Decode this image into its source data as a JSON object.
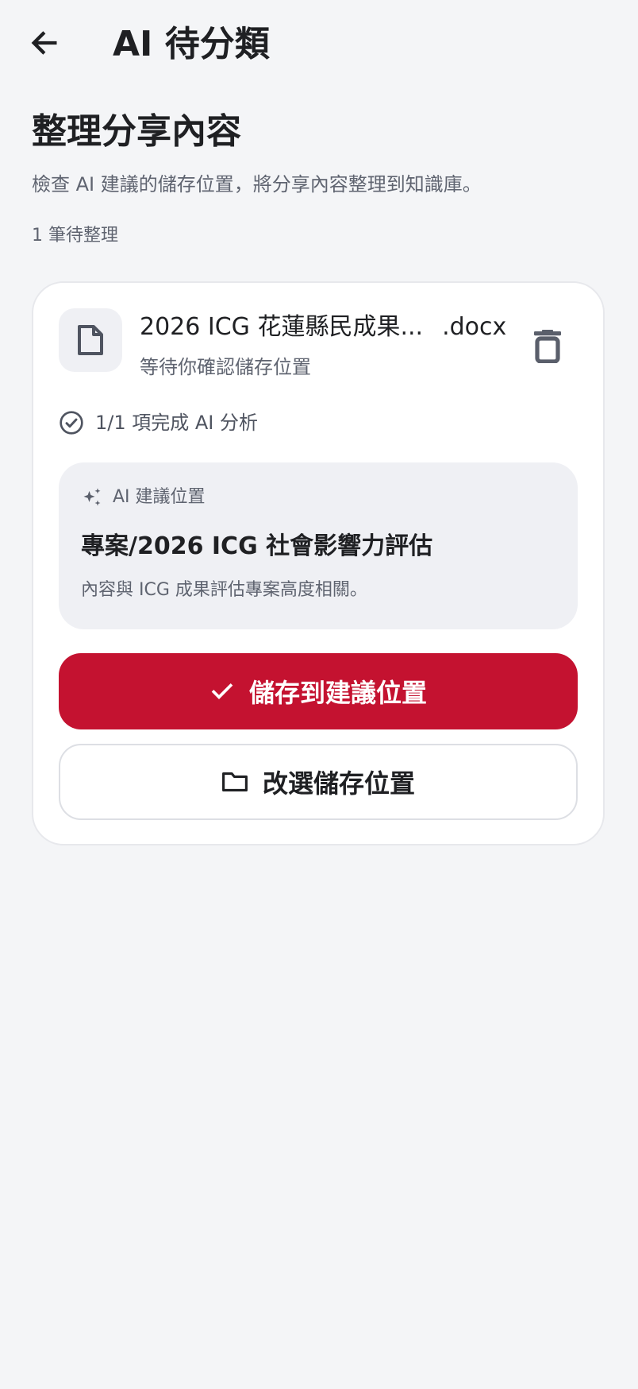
{
  "app_bar": {
    "title": "AI 待分類",
    "back_icon": "arrow-left-icon"
  },
  "section": {
    "heading": "整理分享內容",
    "description": "檢查 AI 建議的儲存位置，將分享內容整理到知識庫。",
    "pending_count": "1 筆待整理"
  },
  "item": {
    "file_icon": "document-icon",
    "file_name_stem": "2026 ICG 花蓮縣民成果...",
    "file_extension": ".docx",
    "status": "等待你確認儲存位置",
    "delete_icon": "trash-icon",
    "analysis_icon": "check-circle-icon",
    "analysis_text": "1/1 項完成 AI 分析",
    "suggestion": {
      "icon": "sparkle-icon",
      "label": "AI 建議位置",
      "path": "專案/2026 ICG 社會影響力評估",
      "reason": "內容與 ICG 成果評估專案高度相關。"
    },
    "save_button": {
      "icon": "check-icon",
      "label": "儲存到建議位置"
    },
    "change_button": {
      "icon": "folder-icon",
      "label": "改選儲存位置"
    }
  },
  "colors": {
    "background": "#f4f5f7",
    "card": "#ffffff",
    "primary": "#c41230",
    "muted_text": "#5f6470",
    "panel": "#eff0f4"
  }
}
